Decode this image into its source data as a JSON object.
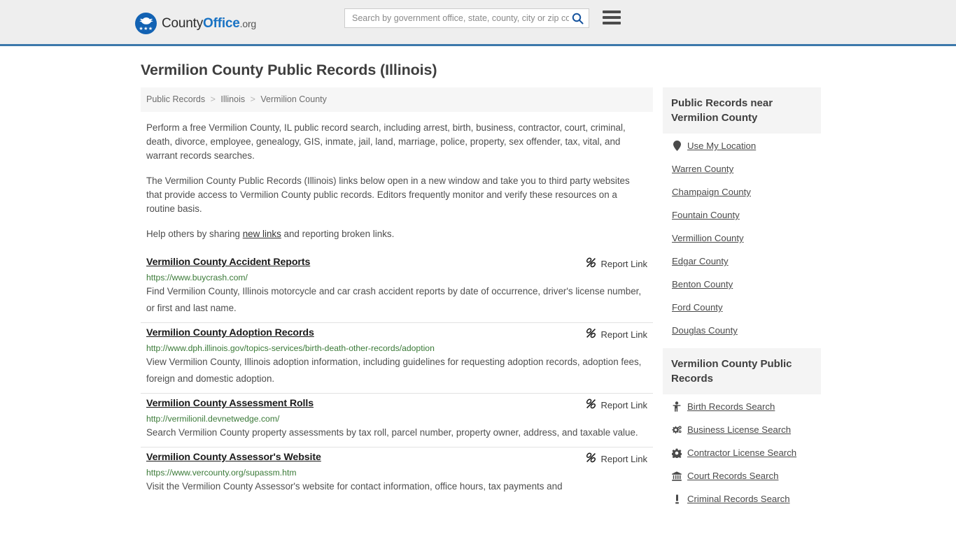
{
  "header": {
    "logo": {
      "part1": "County",
      "part2": "Office",
      "part3": ".org",
      "icon": "eagle-seal-icon"
    },
    "search": {
      "placeholder": "Search by government office, state, county, city or zip code",
      "value": "",
      "icon": "search-icon"
    },
    "menu_icon": "hamburger-menu-icon",
    "accent_color": "#3c78ab"
  },
  "page": {
    "title": "Vermilion County Public Records (Illinois)"
  },
  "breadcrumb": {
    "items": [
      "Public Records",
      "Illinois",
      "Vermilion County"
    ],
    "separator": ">"
  },
  "intro": {
    "paragraph1": "Perform a free Vermilion County, IL public record search, including arrest, birth, business, contractor, court, criminal, death, divorce, employee, genealogy, GIS, inmate, jail, land, marriage, police, property, sex offender, tax, vital, and warrant records searches.",
    "paragraph2": "The Vermilion County Public Records (Illinois) links below open in a new window and take you to third party websites that provide access to Vermilion County public records. Editors frequently monitor and verify these resources on a routine basis.",
    "help_prefix": "Help others by sharing ",
    "help_link": "new links",
    "help_suffix": " and reporting broken links."
  },
  "records": {
    "report_label": "Report Link",
    "report_icon": "broken-link-icon",
    "items": [
      {
        "title": "Vermilion County Accident Reports",
        "url": "https://www.buycrash.com/",
        "description": "Find Vermilion County, Illinois motorcycle and car crash accident reports by date of occurrence, driver's license number, or first and last name."
      },
      {
        "title": "Vermilion County Adoption Records",
        "url": "http://www.dph.illinois.gov/topics-services/birth-death-other-records/adoption",
        "description": "View Vermilion County, Illinois adoption information, including guidelines for requesting adoption records, adoption fees, foreign and domestic adoption."
      },
      {
        "title": "Vermilion County Assessment Rolls",
        "url": "http://vermilionil.devnetwedge.com/",
        "description": "Search Vermilion County property assessments by tax roll, parcel number, property owner, address, and taxable value."
      },
      {
        "title": "Vermilion County Assessor's Website",
        "url": "https://www.vercounty.org/supassm.htm",
        "description": "Visit the Vermilion County Assessor's website for contact information, office hours, tax payments and"
      }
    ]
  },
  "sidebar": {
    "nearby": {
      "heading": "Public Records near Vermilion County",
      "items": [
        {
          "label": "Use My Location",
          "icon": "map-pin-icon"
        },
        {
          "label": "Warren County",
          "icon": ""
        },
        {
          "label": "Champaign County",
          "icon": ""
        },
        {
          "label": "Fountain County",
          "icon": ""
        },
        {
          "label": "Vermillion County",
          "icon": ""
        },
        {
          "label": "Edgar County",
          "icon": ""
        },
        {
          "label": "Benton County",
          "icon": ""
        },
        {
          "label": "Ford County",
          "icon": ""
        },
        {
          "label": "Douglas County",
          "icon": ""
        }
      ]
    },
    "records": {
      "heading": "Vermilion County Public Records",
      "items": [
        {
          "label": "Birth Records Search",
          "icon": "baby-icon"
        },
        {
          "label": "Business License Search",
          "icon": "cogs-icon"
        },
        {
          "label": "Contractor License Search",
          "icon": "gear-icon"
        },
        {
          "label": "Court Records Search",
          "icon": "courthouse-icon"
        },
        {
          "label": "Criminal Records Search",
          "icon": "gavel-icon"
        }
      ]
    }
  }
}
